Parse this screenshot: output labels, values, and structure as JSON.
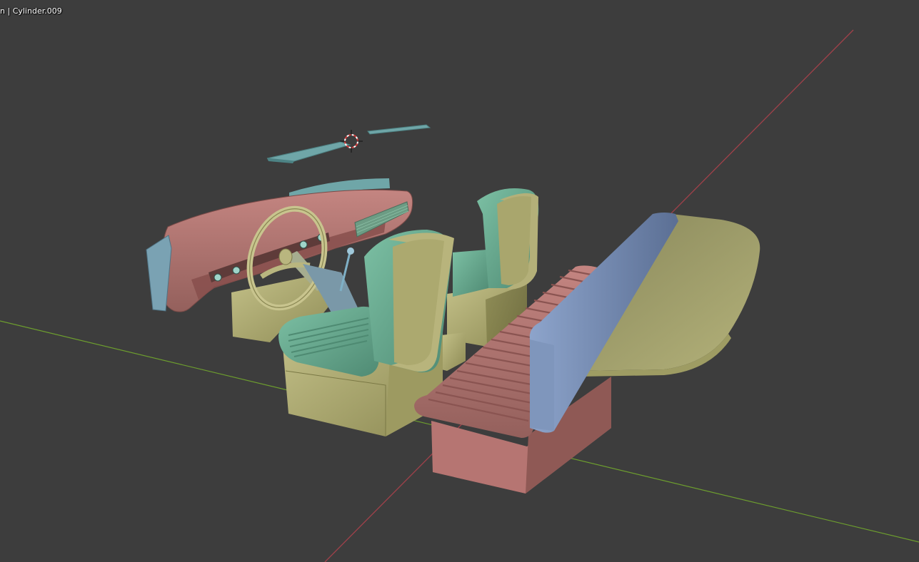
{
  "viewport": {
    "overlay_prefix": "n |",
    "active_object": "Cylinder.009",
    "background": "#3d3d3d"
  },
  "colors": {
    "axis_x": "#a0414a",
    "axis_y": "#6d9e2e",
    "red_material": "#b3726f",
    "red_dark": "#8e5552",
    "green_material": "#6fae96",
    "green_dark": "#538a75",
    "yellow_material": "#b8b57a",
    "yellow_dark": "#8f8c55",
    "blue_material": "#7c93b9",
    "blue_dark": "#5e7498",
    "teal_material": "#6fa6a8"
  },
  "scene_objects": [
    {
      "name": "sun-visor-left"
    },
    {
      "name": "sun-visor-right"
    },
    {
      "name": "3d-cursor"
    },
    {
      "name": "dashboard"
    },
    {
      "name": "steering-wheel"
    },
    {
      "name": "gear-shifter"
    },
    {
      "name": "front-seat-left"
    },
    {
      "name": "front-seat-right"
    },
    {
      "name": "rear-bench-seat"
    },
    {
      "name": "rear-parcel-shelf"
    }
  ]
}
